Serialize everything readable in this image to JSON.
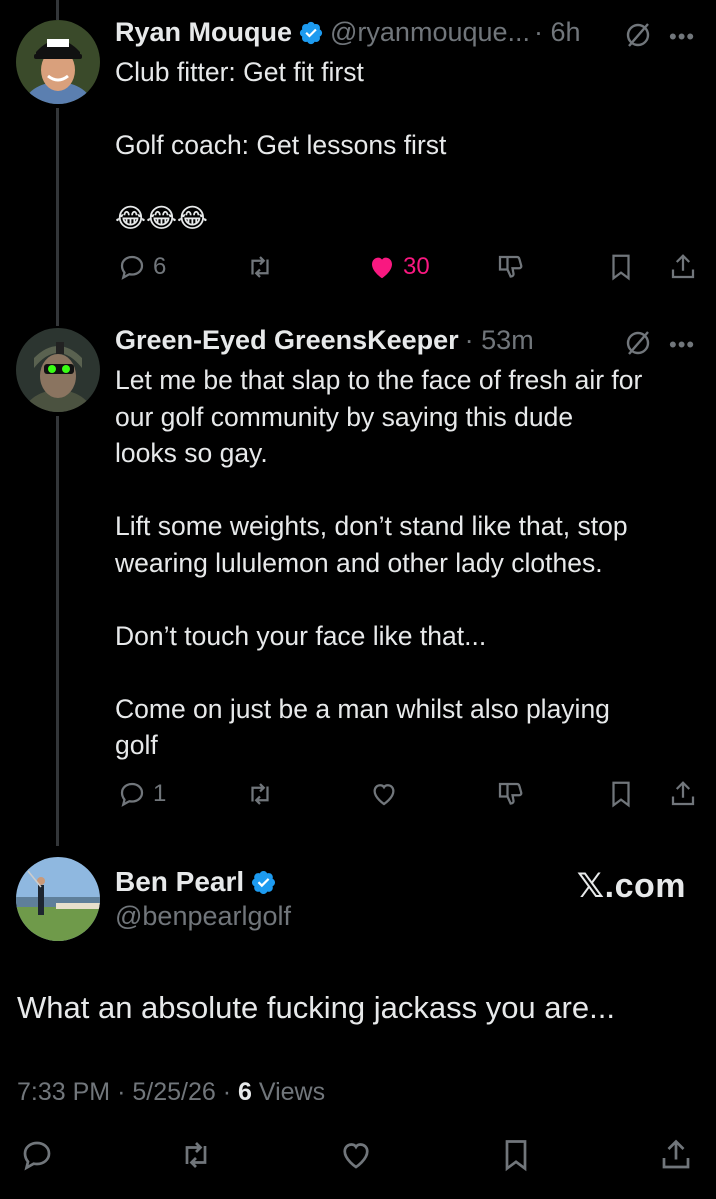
{
  "tweets": [
    {
      "name": "Ryan Mouque",
      "handle": "@ryanmouque...",
      "time": "· 6h",
      "text": "Club fitter: Get fit first\n\nGolf coach: Get lessons first\n\n😂😂😂",
      "replies": "6",
      "retweets": "",
      "likes": "30",
      "liked": true,
      "verified": true
    },
    {
      "name": "Green-Eyed GreensKeeper",
      "handle": "",
      "time": "· 53m",
      "text": "Let me be that slap to the face of fresh air for\nour golf community by saying this dude\nlooks so gay.\n\nLift some weights, don’t stand like that, stop\nwearing lululemon and other lady clothes.\n\nDon’t touch your face like that...\n\nCome on just be a man whilst also playing\ngolf",
      "replies": "1",
      "retweets": "",
      "likes": "",
      "liked": false,
      "verified": false
    }
  ],
  "main_tweet": {
    "name": "Ben Pearl",
    "handle": "@benpearlgolf",
    "source": "𝕏.com",
    "text": "What an absolute fucking jackass you are...",
    "time": "7:33 PM",
    "date": "5/25/26",
    "views_count": "6",
    "views_label": "Views"
  },
  "colors": {
    "background": "#000000",
    "text": "#e7e9ea",
    "muted": "#71767b",
    "like": "#f91880",
    "verified": "#1d9bf0",
    "thread_line": "#333639"
  },
  "icons": [
    "reply-icon",
    "retweet-icon",
    "like-icon",
    "dislike-icon",
    "bookmark-icon",
    "share-icon",
    "grok-icon",
    "more-icon",
    "verified-badge-icon"
  ]
}
